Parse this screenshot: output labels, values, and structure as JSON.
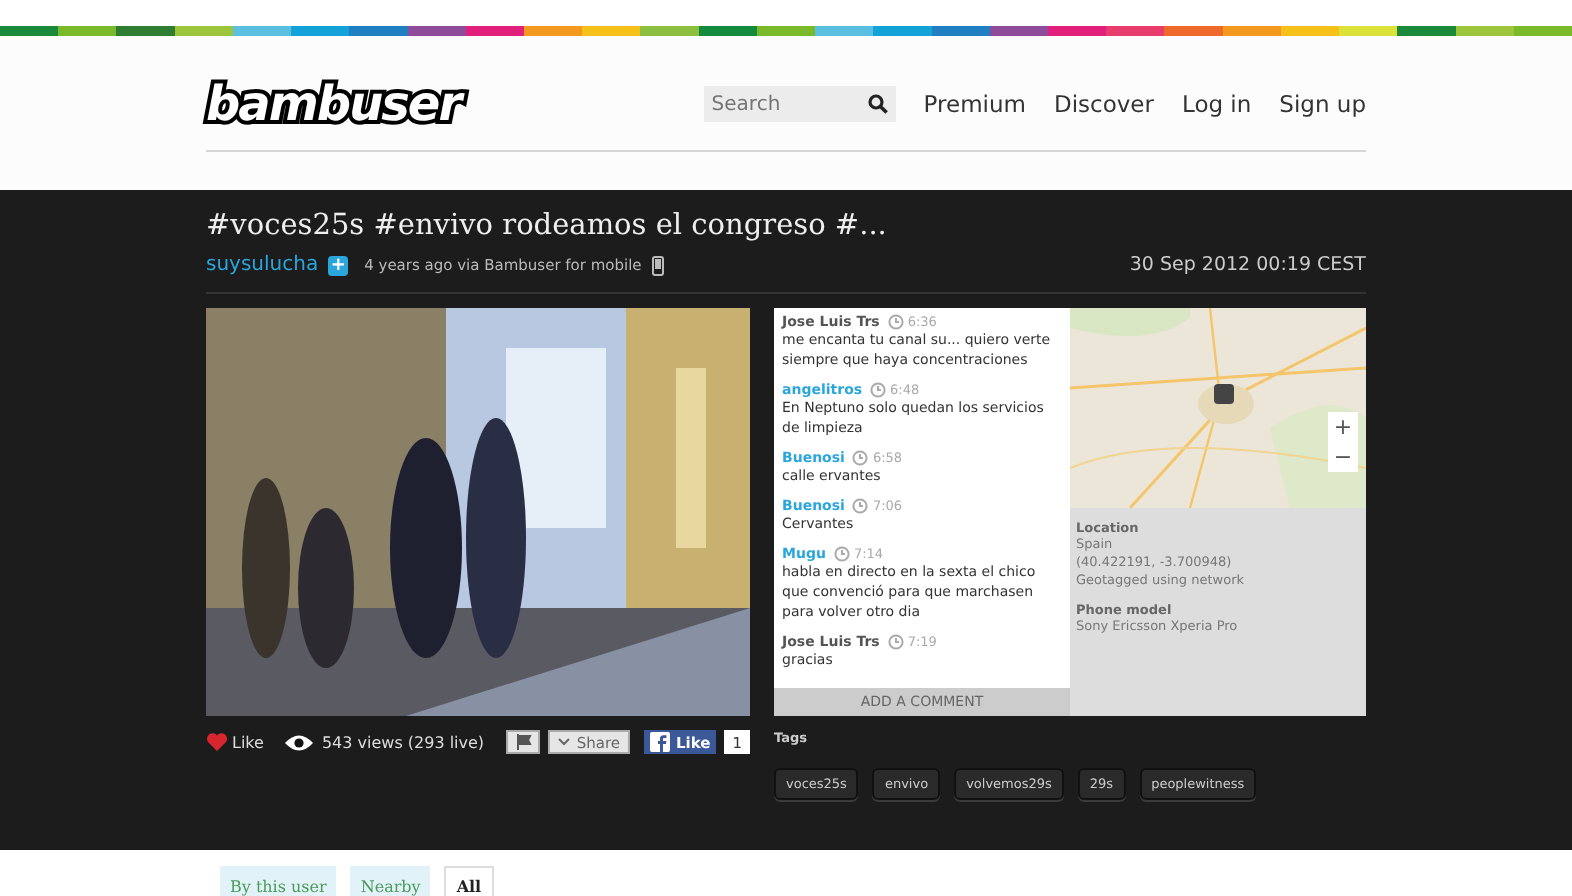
{
  "header": {
    "logo": "bambuser",
    "search": {
      "placeholder": "Search"
    },
    "nav": [
      "Premium",
      "Discover",
      "Log in",
      "Sign up"
    ]
  },
  "broadcast": {
    "title": "#voces25s #envivo rodeamos el congreso #...",
    "user": "suysulucha",
    "user_badge": "+",
    "meta": "4 years ago via Bambuser for mobile",
    "date": "30 Sep 2012 00:19 CEST"
  },
  "comments": [
    {
      "author": "Jose Luis Trs",
      "highlighted": false,
      "time": "6:36",
      "text": "me encanta tu canal su... quiero verte siempre que haya concentraciones"
    },
    {
      "author": "angelitros",
      "highlighted": true,
      "time": "6:48",
      "text": "En Neptuno solo quedan los servicios de limpieza"
    },
    {
      "author": "Buenosi",
      "highlighted": true,
      "time": "6:58",
      "text": "calle ervantes"
    },
    {
      "author": "Buenosi",
      "highlighted": true,
      "time": "7:06",
      "text": "Cervantes"
    },
    {
      "author": "Mugu",
      "highlighted": true,
      "time": "7:14",
      "text": "habla en directo en la sexta el chico que convenció para que marchasen para volver otro dia"
    },
    {
      "author": "Jose Luis Trs",
      "highlighted": false,
      "time": "7:19",
      "text": "gracias"
    }
  ],
  "add_comment": "ADD A COMMENT",
  "map": {
    "zoom_in": "+",
    "zoom_out": "−"
  },
  "location": {
    "label": "Location",
    "lines": [
      "Spain",
      "(40.422191, -3.700948)",
      "Geotagged using network"
    ]
  },
  "phone": {
    "label": "Phone model",
    "value": "Sony Ericsson Xperia Pro"
  },
  "actions": {
    "like": "Like",
    "views": "543 views (293 live)",
    "share": "Share",
    "fb_like": "Like",
    "fb_count": "1"
  },
  "tags": {
    "label": "Tags",
    "items": [
      "voces25s",
      "envivo",
      "volvemos29s",
      "29s",
      "peoplewitness"
    ]
  },
  "filter_tabs": [
    {
      "label": "By this user",
      "selected": false
    },
    {
      "label": "Nearby",
      "selected": false
    },
    {
      "label": "All",
      "selected": true
    }
  ]
}
